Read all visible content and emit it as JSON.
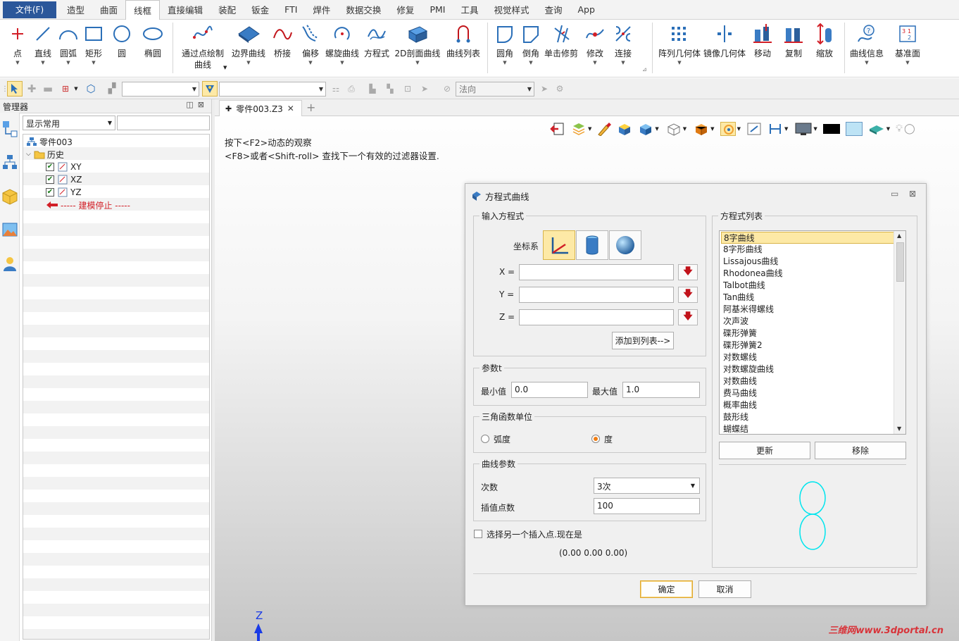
{
  "menu": {
    "file": "文件(F)",
    "tabs": [
      "造型",
      "曲面",
      "线框",
      "直接编辑",
      "装配",
      "钣金",
      "FTI",
      "焊件",
      "数据交换",
      "修复",
      "PMI",
      "工具",
      "视觉样式",
      "查询",
      "App"
    ],
    "active_tab": "线框"
  },
  "ribbon": {
    "point": "点",
    "line": "直线",
    "arc": "圆弧",
    "rect": "矩形",
    "circle": "圆",
    "ellipse": "椭圆",
    "through_points_1": "通过点绘制",
    "through_points_2": "曲线",
    "boundary": "边界曲线",
    "bridge": "桥接",
    "offset": "偏移",
    "helix": "螺旋曲线",
    "equation": "方程式",
    "section2d": "2D剖面曲线",
    "curve_list": "曲线列表",
    "fillet": "圆角",
    "chamfer": "倒角",
    "trim": "单击修剪",
    "modify": "修改",
    "connect": "连接",
    "pattern": "阵列几何体",
    "mirror": "镜像几何体",
    "move": "移动",
    "copy": "复制",
    "scale": "缩放",
    "curve_info": "曲线信息",
    "datum": "基准面"
  },
  "toolbar": {
    "normal_placeholder": "法向"
  },
  "manager": {
    "title": "管理器",
    "filter": "显示常用",
    "tree": {
      "root": "零件003",
      "history": "历史",
      "xy": "XY",
      "xz": "XZ",
      "yz": "YZ",
      "stop": "----- 建模停止 -----"
    }
  },
  "viewport": {
    "doc_tab": "零件003.Z3",
    "hint1": "按下<F2>动态的观察",
    "hint2": "<F8>或者<Shift-roll> 查找下一个有效的过滤器设置.",
    "axis_z": "Z",
    "watermark": "三维网www.3dportal.cn"
  },
  "dialog": {
    "title": "方程式曲线",
    "input_group": "输入方程式",
    "coord_label": "坐标系",
    "x_label": "X =",
    "y_label": "Y =",
    "z_label": "Z =",
    "add_to_list": "添加到列表-->",
    "param_group": "参数t",
    "min_label": "最小值",
    "min_value": "0.0",
    "max_label": "最大值",
    "max_value": "1.0",
    "trig_group": "三角函数单位",
    "radian": "弧度",
    "degree": "度",
    "curve_param_group": "曲线参数",
    "degree_label": "次数",
    "degree_value": "3次",
    "interp_label": "插值点数",
    "interp_value": "100",
    "insert_point_label": "选择另一个插入点.现在是",
    "insert_point_value": "(0.00 0.00 0.00)",
    "list_group": "方程式列表",
    "equations": [
      "8字曲线",
      "8字形曲线",
      "Lissajous曲线",
      "Rhodonea曲线",
      "Talbot曲线",
      "Tan曲线",
      "阿基米得螺线",
      "次声波",
      "碟形弹簧",
      "碟形弹簧2",
      "对数螺线",
      "对数螺旋曲线",
      "对数曲线",
      "费马曲线",
      "概率曲线",
      "鼓形线",
      "蝴蝶结"
    ],
    "update_btn": "更新",
    "remove_btn": "移除",
    "ok_btn": "确定",
    "cancel_btn": "取消"
  },
  "colors": {
    "accent": "#2b579a",
    "selection": "#fde9a6",
    "preview_curve": "#00e5ee",
    "error_arrow": "#c1121a"
  }
}
